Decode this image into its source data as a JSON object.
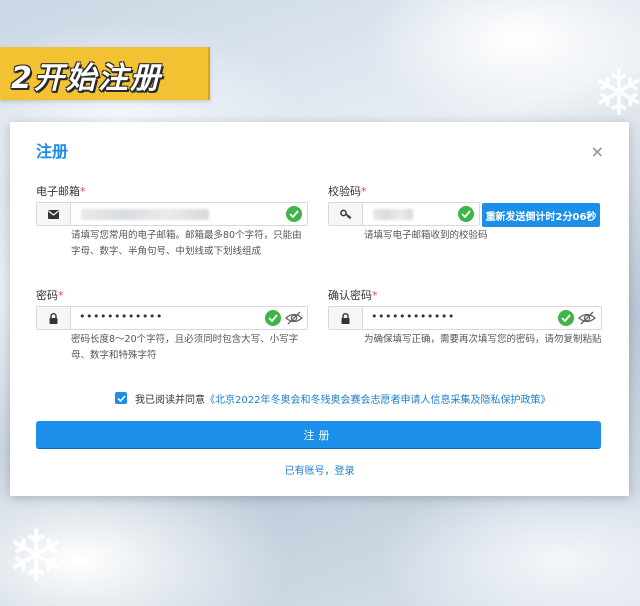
{
  "banner": {
    "text": "2开始注册"
  },
  "dialog": {
    "title": "注册",
    "close_glyph": "×",
    "email": {
      "label": "电子邮箱",
      "required_mark": "*",
      "hint": "请填写您常用的电子邮箱。邮箱最多80个字符，只能由字母、数字、半角句号、中划线或下划线组成"
    },
    "code": {
      "label": "校验码",
      "required_mark": "*",
      "hint": "请填写电子邮箱收到的校验码",
      "send_button": "重新发送倒计时2分06秒"
    },
    "password": {
      "label": "密码",
      "required_mark": "*",
      "value": "••••••••••••",
      "hint": "密码长度8～20个字符，且必须同时包含大写、小写字母、数字和特殊字符"
    },
    "confirm": {
      "label": "确认密码",
      "required_mark": "*",
      "value": "••••••••••••",
      "hint": "为确保填写正确，需要再次填写您的密码，请勿复制粘贴"
    },
    "agree": {
      "text": "我已阅读并同意",
      "link": "《北京2022年冬奥会和冬残奥会赛会志愿者申请人信息采集及隐私保护政策》",
      "checked": true
    },
    "submit_label": "注册",
    "login_link": "已有账号，登录"
  },
  "icons": {
    "email_prefix": "envelope-icon",
    "code_prefix": "key-icon",
    "password_prefix": "lock-icon",
    "valid": "check-circle-icon",
    "visibility": "eye-slash-icon"
  },
  "colors": {
    "accent": "#1b8fe9",
    "banner": "#f3c233",
    "valid": "#3fb44a",
    "required": "#e24a4a"
  }
}
